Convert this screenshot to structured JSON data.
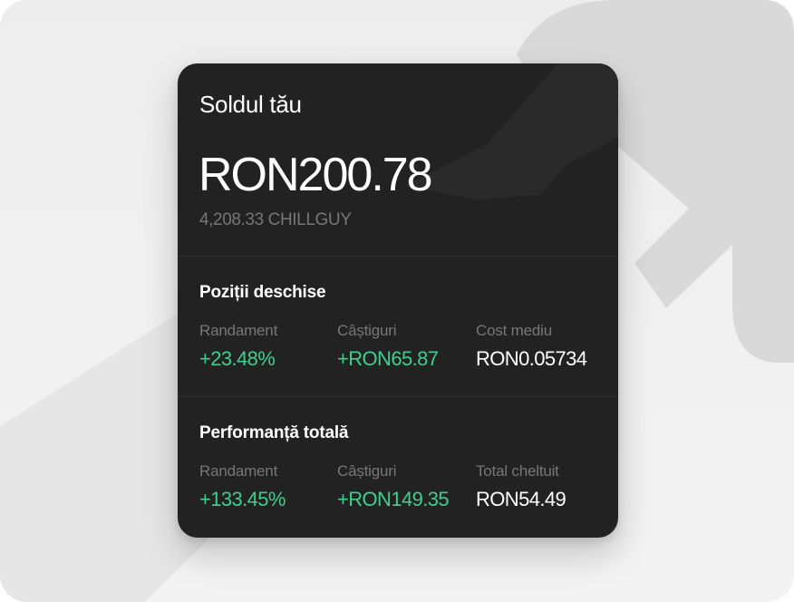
{
  "balance_card": {
    "title": "Soldul tău",
    "balance": "RON200.78",
    "token_amount": "4,208.33 CHILLGUY"
  },
  "open_positions": {
    "title": "Poziții deschise",
    "stats": [
      {
        "label": "Randament",
        "value": "+23.48%",
        "tone": "positive"
      },
      {
        "label": "Câștiguri",
        "value": "+RON65.87",
        "tone": "positive"
      },
      {
        "label": "Cost mediu",
        "value": "RON0.05734",
        "tone": "neutral"
      }
    ]
  },
  "total_performance": {
    "title": "Performanță totală",
    "stats": [
      {
        "label": "Randament",
        "value": "+133.45%",
        "tone": "positive"
      },
      {
        "label": "Câștiguri",
        "value": "+RON149.35",
        "tone": "positive"
      },
      {
        "label": "Total cheltuit",
        "value": "RON54.49",
        "tone": "neutral"
      }
    ]
  },
  "colors": {
    "card_background": "#222222",
    "positive": "#3ecf8e",
    "muted": "#777777",
    "page_background": "#efefef"
  },
  "icons": {
    "background_decoration": "trend-arrow-icon"
  }
}
